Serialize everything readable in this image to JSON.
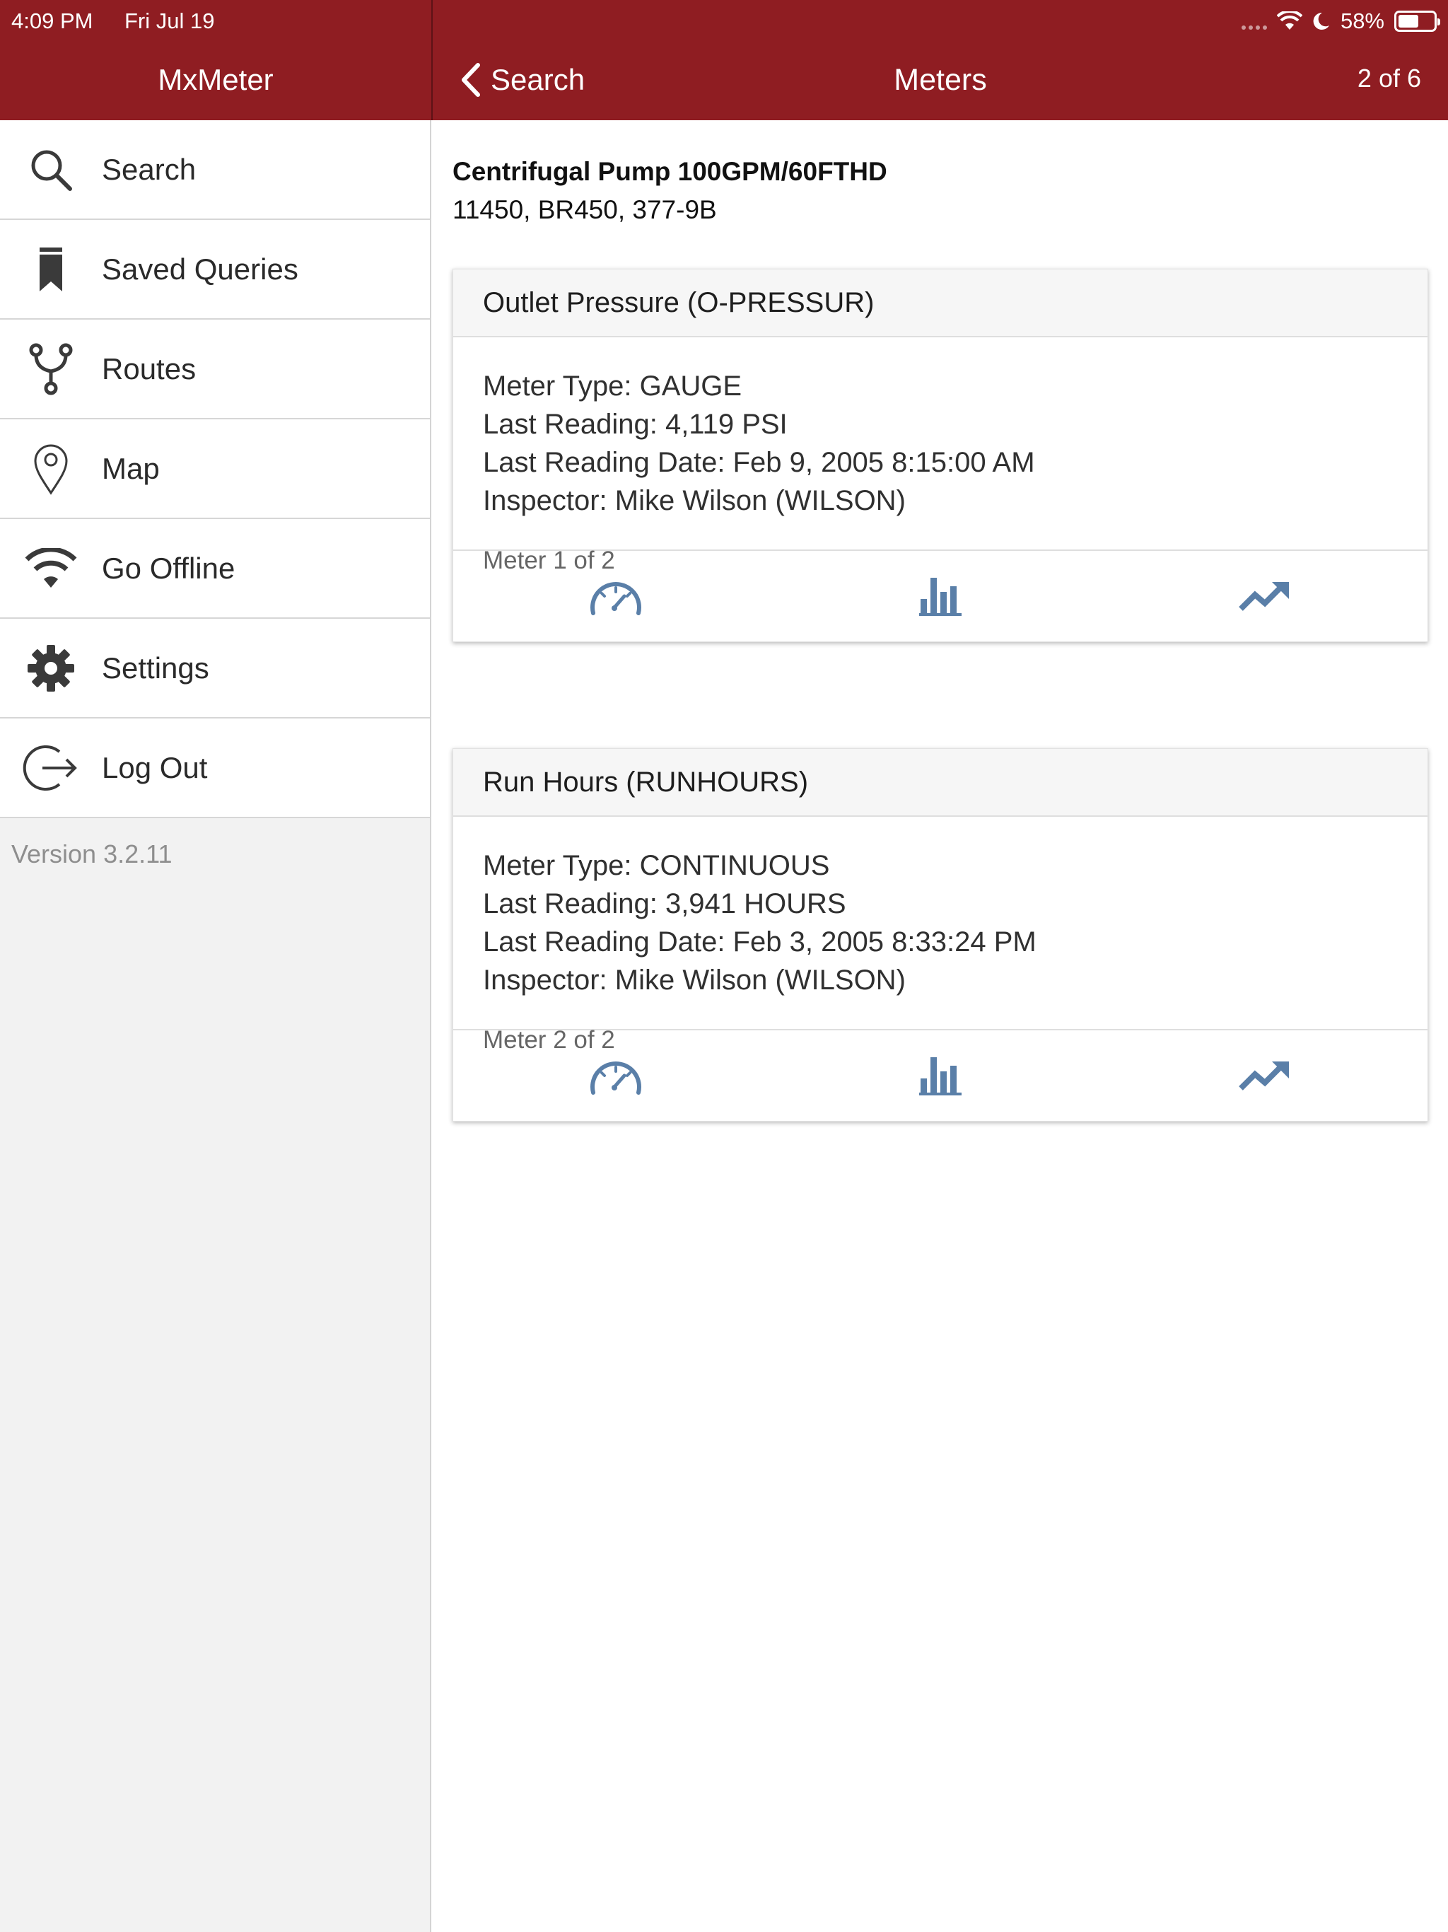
{
  "status_bar": {
    "time": "4:09 PM",
    "date": "Fri Jul 19",
    "battery": "58%",
    "battery_level": 0.58
  },
  "sidebar": {
    "title": "MxMeter",
    "items": [
      {
        "label": "Search",
        "icon": "search-icon"
      },
      {
        "label": "Saved Queries",
        "icon": "bookmark-icon"
      },
      {
        "label": "Routes",
        "icon": "routes-icon"
      },
      {
        "label": "Map",
        "icon": "map-pin-icon"
      },
      {
        "label": "Go Offline",
        "icon": "wifi-icon"
      },
      {
        "label": "Settings",
        "icon": "gear-icon"
      },
      {
        "label": "Log Out",
        "icon": "logout-icon"
      }
    ],
    "version": "Version 3.2.11"
  },
  "nav": {
    "back_label": "Search",
    "title": "Meters",
    "pager": "2 of 6"
  },
  "asset": {
    "title": "Centrifugal Pump 100GPM/60FTHD",
    "subtitle": "11450, BR450, 377-9B"
  },
  "meters": [
    {
      "name": "Outlet Pressure (O-PRESSUR)",
      "type": "Meter Type: GAUGE",
      "last_reading": "Last Reading: 4,119 PSI",
      "last_date": "Last Reading Date: Feb 9, 2005 8:15:00 AM",
      "inspector": "Inspector: Mike Wilson (WILSON)",
      "count": "Meter 1 of 2"
    },
    {
      "name": "Run Hours (RUNHOURS)",
      "type": "Meter Type: CONTINUOUS",
      "last_reading": "Last Reading: 3,941 HOURS",
      "last_date": "Last Reading Date: Feb 3, 2005 8:33:24 PM",
      "inspector": "Inspector: Mike Wilson (WILSON)",
      "count": "Meter 2 of 2"
    }
  ],
  "actions": [
    {
      "icon": "gauge-icon"
    },
    {
      "icon": "bar-chart-icon"
    },
    {
      "icon": "trend-icon"
    }
  ],
  "colors": {
    "header": "#8f1d22",
    "action_icon": "#5a7fa8",
    "menu_icon": "#3a3a3a"
  }
}
